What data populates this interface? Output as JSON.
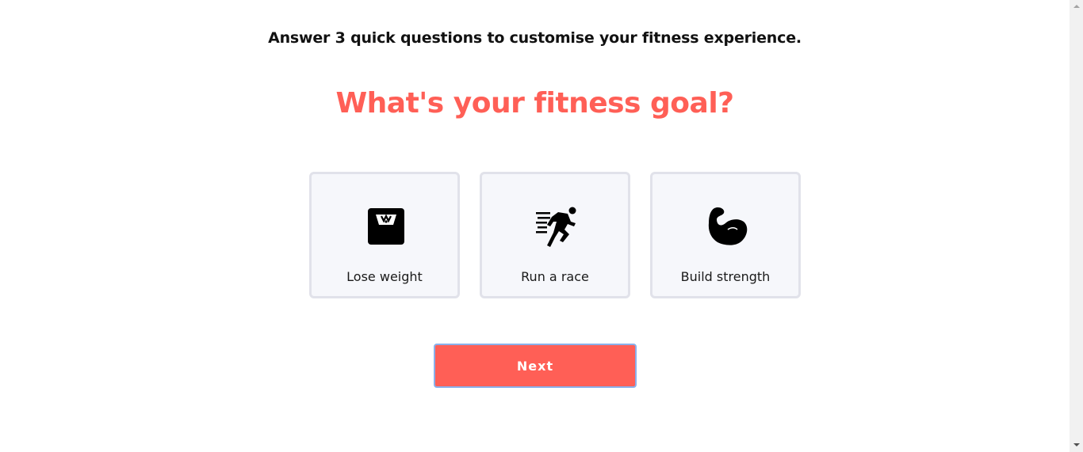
{
  "header": {
    "intro": "Answer 3 quick questions to customise your fitness experience.",
    "question": "What's your fitness goal?"
  },
  "options": [
    {
      "label": "Lose weight",
      "icon": "scale-icon"
    },
    {
      "label": "Run a race",
      "icon": "runner-icon"
    },
    {
      "label": "Build strength",
      "icon": "flexed-arm-icon"
    }
  ],
  "actions": {
    "next_label": "Next"
  },
  "colors": {
    "accent": "#ff5f56",
    "card_background": "#f6f7fb",
    "card_border": "#e1e2ea",
    "focus_ring": "#8ab0ea"
  }
}
